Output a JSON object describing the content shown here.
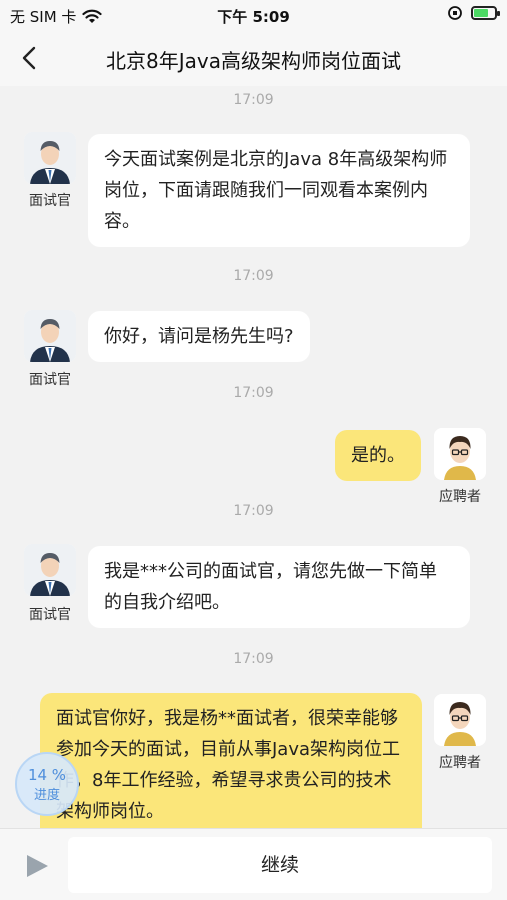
{
  "status_bar": {
    "carrier": "无 SIM 卡",
    "time": "下午 5:09"
  },
  "nav": {
    "title": "北京8年Java高级架构师岗位面试"
  },
  "messages": [
    {
      "time": "17:09",
      "role": "面试官",
      "side": "left",
      "text": "今天面试案例是北京的Java 8年高级架构师岗位，下面请跟随我们一同观看本案例内容。"
    },
    {
      "time": "17:09",
      "role": "面试官",
      "side": "left",
      "text": "你好，请问是杨先生吗?"
    },
    {
      "time": "17:09",
      "role": "应聘者",
      "side": "right",
      "text": "是的。"
    },
    {
      "time": "17:09",
      "role": "面试官",
      "side": "left",
      "text": "我是***公司的面试官，请您先做一下简单的自我介绍吧。"
    },
    {
      "time": "17:09",
      "role": "应聘者",
      "side": "right",
      "text": "面试官你好，我是杨**面试者，很荣幸能够参加今天的面试，目前从事Java架构岗位工作，8年工作经验，希望寻求贵公司的技术架构师岗位。"
    }
  ],
  "progress": {
    "value": "14 %",
    "label": "进度"
  },
  "bottom": {
    "continue_label": "继续"
  },
  "colors": {
    "bubble_user": "#fbe67a",
    "bubble_interviewer": "#ffffff",
    "background": "#f2f2f2"
  }
}
